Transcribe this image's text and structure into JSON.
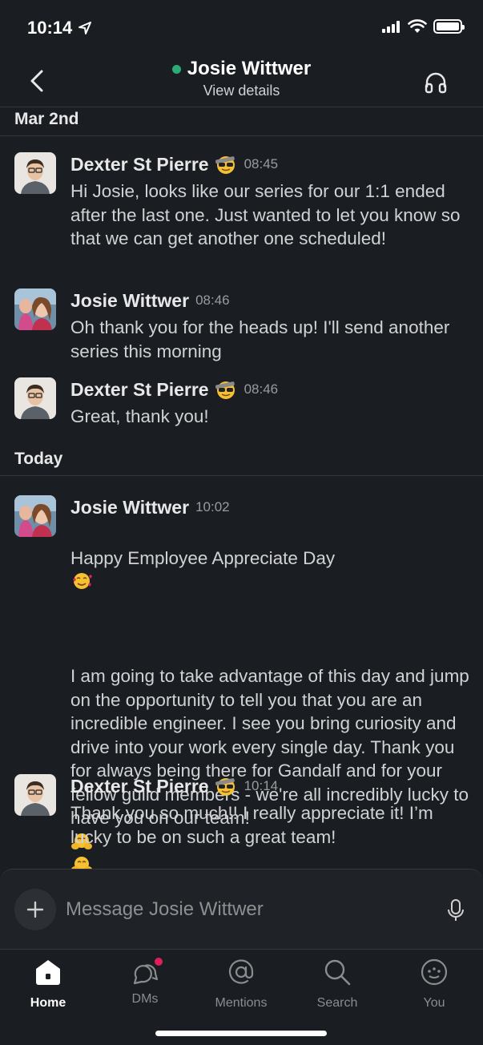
{
  "status_bar": {
    "time": "10:14"
  },
  "header": {
    "title": "Josie Wittwer",
    "subtitle": "View details"
  },
  "messages": {
    "day1": "Mar 2nd",
    "day2": "Today",
    "m1": {
      "name": "Dexter St Pierre",
      "time": "08:45",
      "text": "Hi Josie, looks like our series for our 1:1 ended after the last one. Just wanted to let you know so that we can get another one scheduled!"
    },
    "m2": {
      "name": "Josie Wittwer",
      "time": "08:46",
      "text": "Oh thank you for the heads up! I'll send another series this morning"
    },
    "m3": {
      "name": "Dexter St Pierre",
      "time": "08:46",
      "text": "Great, thank you!"
    },
    "m4": {
      "name": "Josie Wittwer",
      "time": "10:02",
      "line1": "Happy Employee Appreciate Day",
      "text": "I am going to take advantage of this day and jump on the opportunity to tell you that you are an incredible engineer. I see you bring curiosity and drive into your work every single day. Thank you for always being there for Gandalf and for your fellow guild members - we're all incredibly lucky to have you on our team!"
    },
    "m5": {
      "name": "Dexter St Pierre",
      "time": "10:14",
      "text": "Thank you so much!! I really appreciate it! I’m lucky to be on such a great team!"
    }
  },
  "composer": {
    "placeholder": "Message Josie Wittwer"
  },
  "tabs": {
    "home": "Home",
    "dms": "DMs",
    "mentions": "Mentions",
    "search": "Search",
    "you": "You"
  },
  "colors": {
    "background": "#1a1d21",
    "presence": "#2bac76",
    "badge": "#e01e5a"
  },
  "icons": {
    "status_emoji": "sunglasses-emoji-icon",
    "heart_face": "smiling-face-with-hearts-icon",
    "hugging": "hugging-face-icon"
  }
}
